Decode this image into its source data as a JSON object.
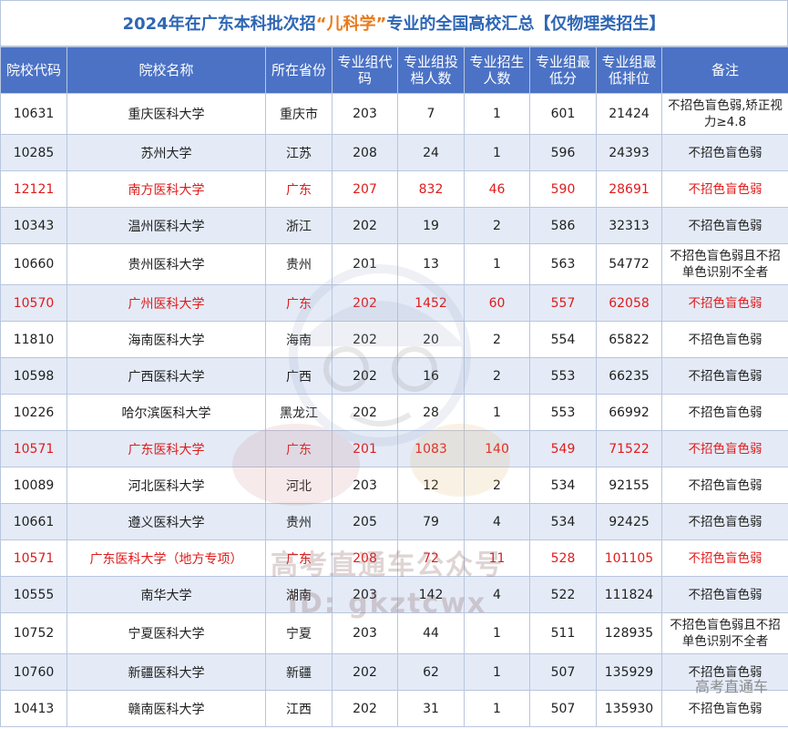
{
  "title": {
    "pre": "2024年在广东本科批次招",
    "highlight": "“儿科学”",
    "post": "专业的全国高校汇总【仅物理类招生】"
  },
  "headers": {
    "code": "院校代码",
    "name": "院校名称",
    "province": "所在省份",
    "group_code": "专业组代码",
    "applicants": "专业组投档人数",
    "enroll": "专业招生人数",
    "min_score": "专业组最低分",
    "min_rank": "专业组最低排位",
    "note": "备注"
  },
  "rows": [
    {
      "code": "10631",
      "name": "重庆医科大学",
      "province": "重庆市",
      "group": "203",
      "applicants": "7",
      "enroll": "1",
      "score": "601",
      "rank": "21424",
      "note": "不招色盲色弱,矫正视力≥4.8"
    },
    {
      "code": "10285",
      "name": "苏州大学",
      "province": "江苏",
      "group": "208",
      "applicants": "24",
      "enroll": "1",
      "score": "596",
      "rank": "24393",
      "note": "不招色盲色弱"
    },
    {
      "code": "12121",
      "name": "南方医科大学",
      "province": "广东",
      "group": "207",
      "applicants": "832",
      "enroll": "46",
      "score": "590",
      "rank": "28691",
      "note": "不招色盲色弱"
    },
    {
      "code": "10343",
      "name": "温州医科大学",
      "province": "浙江",
      "group": "202",
      "applicants": "19",
      "enroll": "2",
      "score": "586",
      "rank": "32313",
      "note": "不招色盲色弱"
    },
    {
      "code": "10660",
      "name": "贵州医科大学",
      "province": "贵州",
      "group": "201",
      "applicants": "13",
      "enroll": "1",
      "score": "563",
      "rank": "54772",
      "note": "不招色盲色弱且不招单色识别不全者"
    },
    {
      "code": "10570",
      "name": "广州医科大学",
      "province": "广东",
      "group": "202",
      "applicants": "1452",
      "enroll": "60",
      "score": "557",
      "rank": "62058",
      "note": "不招色盲色弱"
    },
    {
      "code": "11810",
      "name": "海南医科大学",
      "province": "海南",
      "group": "202",
      "applicants": "20",
      "enroll": "2",
      "score": "554",
      "rank": "65822",
      "note": "不招色盲色弱"
    },
    {
      "code": "10598",
      "name": "广西医科大学",
      "province": "广西",
      "group": "202",
      "applicants": "16",
      "enroll": "2",
      "score": "553",
      "rank": "66235",
      "note": "不招色盲色弱"
    },
    {
      "code": "10226",
      "name": "哈尔滨医科大学",
      "province": "黑龙江",
      "group": "202",
      "applicants": "28",
      "enroll": "1",
      "score": "553",
      "rank": "66992",
      "note": "不招色盲色弱"
    },
    {
      "code": "10571",
      "name": "广东医科大学",
      "province": "广东",
      "group": "201",
      "applicants": "1083",
      "enroll": "140",
      "score": "549",
      "rank": "71522",
      "note": "不招色盲色弱"
    },
    {
      "code": "10089",
      "name": "河北医科大学",
      "province": "河北",
      "group": "203",
      "applicants": "12",
      "enroll": "2",
      "score": "534",
      "rank": "92155",
      "note": "不招色盲色弱"
    },
    {
      "code": "10661",
      "name": "遵义医科大学",
      "province": "贵州",
      "group": "205",
      "applicants": "79",
      "enroll": "4",
      "score": "534",
      "rank": "92425",
      "note": "不招色盲色弱"
    },
    {
      "code": "10571",
      "name": "广东医科大学（地方专项）",
      "province": "广东",
      "group": "208",
      "applicants": "72",
      "enroll": "11",
      "score": "528",
      "rank": "101105",
      "note": "不招色盲色弱"
    },
    {
      "code": "10555",
      "name": "南华大学",
      "province": "湖南",
      "group": "203",
      "applicants": "142",
      "enroll": "4",
      "score": "522",
      "rank": "111824",
      "note": "不招色盲色弱"
    },
    {
      "code": "10752",
      "name": "宁夏医科大学",
      "province": "宁夏",
      "group": "203",
      "applicants": "44",
      "enroll": "1",
      "score": "511",
      "rank": "128935",
      "note": "不招色盲色弱且不招单色识别不全者"
    },
    {
      "code": "10760",
      "name": "新疆医科大学",
      "province": "新疆",
      "group": "202",
      "applicants": "62",
      "enroll": "1",
      "score": "507",
      "rank": "135929",
      "note": "不招色盲色弱"
    },
    {
      "code": "10413",
      "name": "赣南医科大学",
      "province": "江西",
      "group": "202",
      "applicants": "31",
      "enroll": "1",
      "score": "507",
      "rank": "135930",
      "note": "不招色盲色弱"
    }
  ],
  "highlight_rows": [
    2,
    5,
    9,
    12
  ],
  "tall_rows": [
    0,
    4,
    14
  ],
  "watermark": {
    "center_text": "高考直通车公众号",
    "id_text": "ID: gkztcwx",
    "corner_text": "高考直通车"
  },
  "colors": {
    "title": "#2e66b5",
    "title_highlight": "#e77b1d",
    "header_bg": "#4b72c5",
    "row_alt": "#e4ebf7",
    "red_text": "#e01b1b"
  },
  "icons": {
    "watermark_logo": "mascot-logo-icon"
  }
}
